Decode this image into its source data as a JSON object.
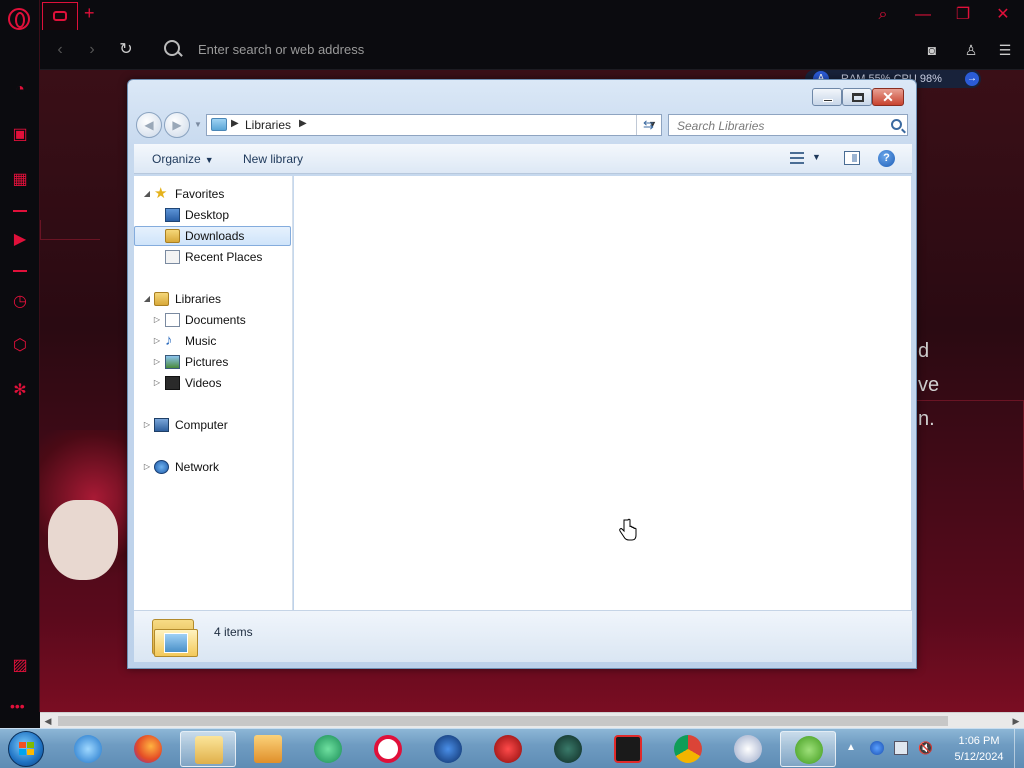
{
  "browser": {
    "address_placeholder": "Enter search or web address",
    "perf_badge": "A",
    "perf_text": "RAM 55%  CPU 98%",
    "side_text": [
      "d",
      "ve",
      "n."
    ]
  },
  "explorer": {
    "address_segment": "Libraries",
    "search_placeholder": "Search Libraries",
    "toolbar": {
      "organize": "Organize",
      "new_library": "New library"
    },
    "nav": {
      "favorites": "Favorites",
      "desktop": "Desktop",
      "downloads": "Downloads",
      "recent_places": "Recent Places",
      "libraries": "Libraries",
      "documents": "Documents",
      "music": "Music",
      "pictures": "Pictures",
      "videos": "Videos",
      "computer": "Computer",
      "network": "Network"
    },
    "status_count": "4 items"
  },
  "taskbar": {
    "clock_time": "1:06 PM",
    "clock_date": "5/12/2024",
    "apps": [
      "internet-explorer",
      "firefox",
      "windows-explorer",
      "media-player",
      "app-green",
      "opera-gx",
      "ccleaner",
      "app-red",
      "app-vpn",
      "screen-recorder",
      "chrome",
      "bittorrent",
      "utorrent"
    ]
  },
  "colors": {
    "accent": "#e0103a",
    "selection": "#cfe4fa",
    "window_frame": "#bcd1ea"
  }
}
